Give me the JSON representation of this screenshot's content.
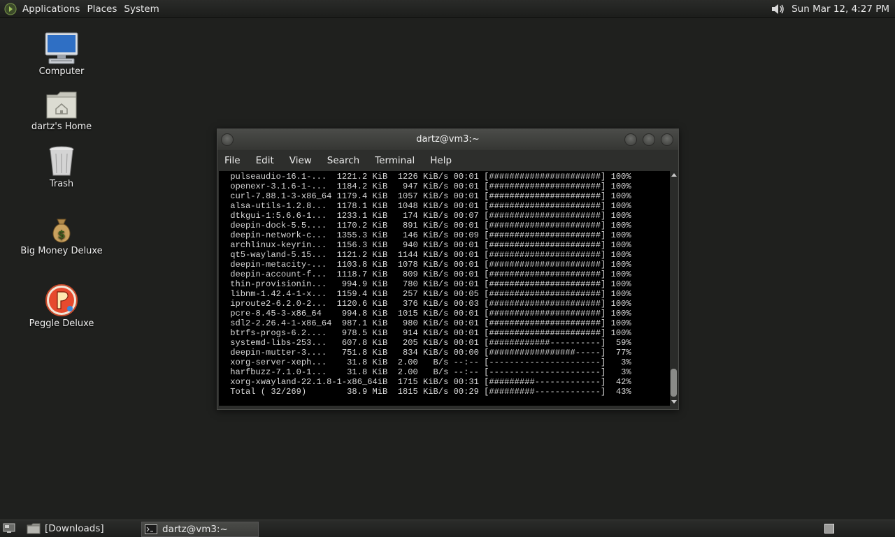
{
  "top_panel": {
    "menus": [
      "Applications",
      "Places",
      "System"
    ],
    "clock": "Sun Mar 12,  4:27 PM"
  },
  "desktop": {
    "icons": [
      {
        "label": "Computer",
        "icon": "computer-icon"
      },
      {
        "label": "dartz's Home",
        "icon": "home-folder-icon"
      },
      {
        "label": "Trash",
        "icon": "trash-icon"
      },
      {
        "label": "Big Money Deluxe",
        "icon": "money-bag-icon"
      },
      {
        "label": "Peggle Deluxe",
        "icon": "peggle-icon"
      }
    ]
  },
  "terminal": {
    "title": "dartz@vm3:~",
    "menu": [
      "File",
      "Edit",
      "View",
      "Search",
      "Terminal",
      "Help"
    ],
    "lines": [
      " pulseaudio-16.1-...  1221.2 KiB  1226 KiB/s 00:01 [######################] 100%",
      " openexr-3.1.6-1-...  1184.2 KiB   947 KiB/s 00:01 [######################] 100%",
      " curl-7.88.1-3-x86_64 1179.4 KiB  1057 KiB/s 00:01 [######################] 100%",
      " alsa-utils-1.2.8...  1178.1 KiB  1048 KiB/s 00:01 [######################] 100%",
      " dtkgui-1:5.6.6-1...  1233.1 KiB   174 KiB/s 00:07 [######################] 100%",
      " deepin-dock-5.5....  1170.2 KiB   891 KiB/s 00:01 [######################] 100%",
      " deepin-network-c...  1355.3 KiB   146 KiB/s 00:09 [######################] 100%",
      " archlinux-keyrin...  1156.3 KiB   940 KiB/s 00:01 [######################] 100%",
      " qt5-wayland-5.15...  1121.2 KiB  1144 KiB/s 00:01 [######################] 100%",
      " deepin-metacity-...  1103.8 KiB  1078 KiB/s 00:01 [######################] 100%",
      " deepin-account-f...  1118.7 KiB   809 KiB/s 00:01 [######################] 100%",
      " thin-provisionin...   994.9 KiB   780 KiB/s 00:01 [######################] 100%",
      " libnm-1.42.4-1-x...  1159.4 KiB   257 KiB/s 00:05 [######################] 100%",
      " iproute2-6.2.0-2...  1120.6 KiB   376 KiB/s 00:03 [######################] 100%",
      " pcre-8.45-3-x86_64    994.8 KiB  1015 KiB/s 00:01 [######################] 100%",
      " sdl2-2.26.4-1-x86_64  987.1 KiB   980 KiB/s 00:01 [######################] 100%",
      " btrfs-progs-6.2....   978.5 KiB   914 KiB/s 00:01 [######################] 100%",
      " systemd-libs-253...   607.8 KiB   205 KiB/s 00:01 [############----------]  59%",
      " deepin-mutter-3....   751.8 KiB   834 KiB/s 00:00 [#################-----]  77%",
      " xorg-server-xeph...    31.8 KiB  2.00   B/s --:-- [----------------------]   3%",
      " harfbuzz-7.1.0-1...    31.8 KiB  2.00   B/s --:-- [----------------------]   3%",
      " xorg-xwayland-22.1.8-1-x86_64iB  1715 KiB/s 00:31 [#########-------------]  42%",
      " Total ( 32/269)        38.9 MiB  1815 KiB/s 00:29 [#########-------------]  43%"
    ]
  },
  "taskbar": {
    "items": [
      {
        "label": "[Downloads]",
        "icon": "folder-icon"
      },
      {
        "label": "dartz@vm3:~",
        "icon": "terminal-icon"
      }
    ]
  }
}
